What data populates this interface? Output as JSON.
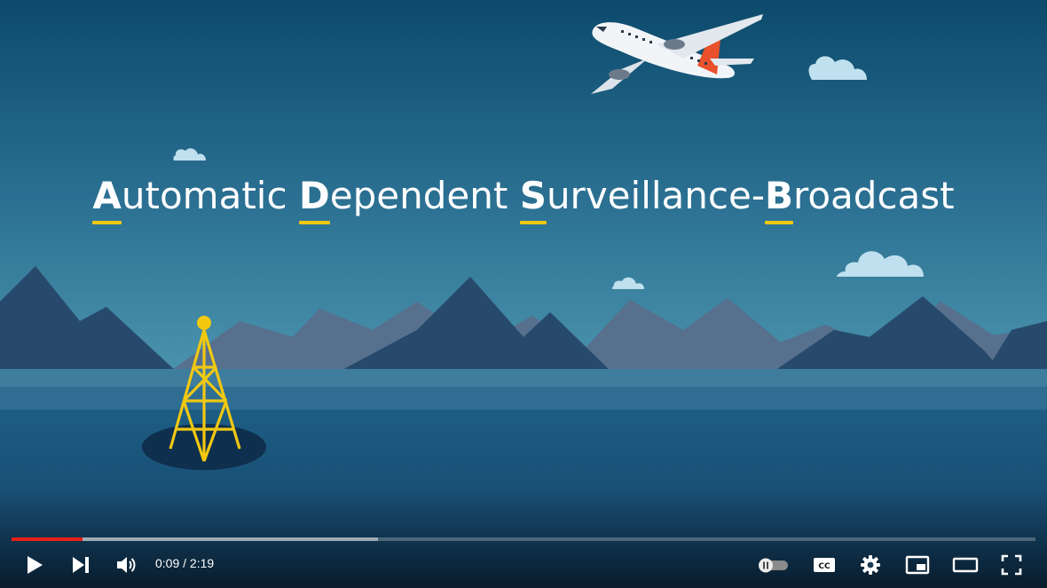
{
  "video": {
    "title_parts": [
      {
        "initial": "A",
        "rest": "utomatic "
      },
      {
        "initial": "D",
        "rest": "ependent "
      },
      {
        "initial": "S",
        "rest": "urveillance-"
      },
      {
        "initial": "B",
        "rest": "roadcast"
      }
    ]
  },
  "player": {
    "current_time": "0:09",
    "time_separator": " / ",
    "duration": "2:19",
    "played_fraction": 0.069,
    "buffered_fraction": 0.358,
    "autoplay_state": "on",
    "controls": {
      "play": "play-icon",
      "next": "skip-next-icon",
      "volume": "volume-icon",
      "autoplay": "autoplay-toggle-icon",
      "captions": "closed-captions-icon",
      "settings": "gear-icon",
      "miniplayer": "miniplayer-icon",
      "theater": "theater-mode-icon",
      "fullscreen": "fullscreen-icon"
    },
    "captions_label": "CC"
  },
  "colors": {
    "sky_top": "#0e4c6e",
    "sky_bottom": "#3f8aa6",
    "accent_underline": "#f2c811",
    "progress_played": "#e62117",
    "tower": "#f2c811",
    "airplane_tail": "#e8512b"
  }
}
